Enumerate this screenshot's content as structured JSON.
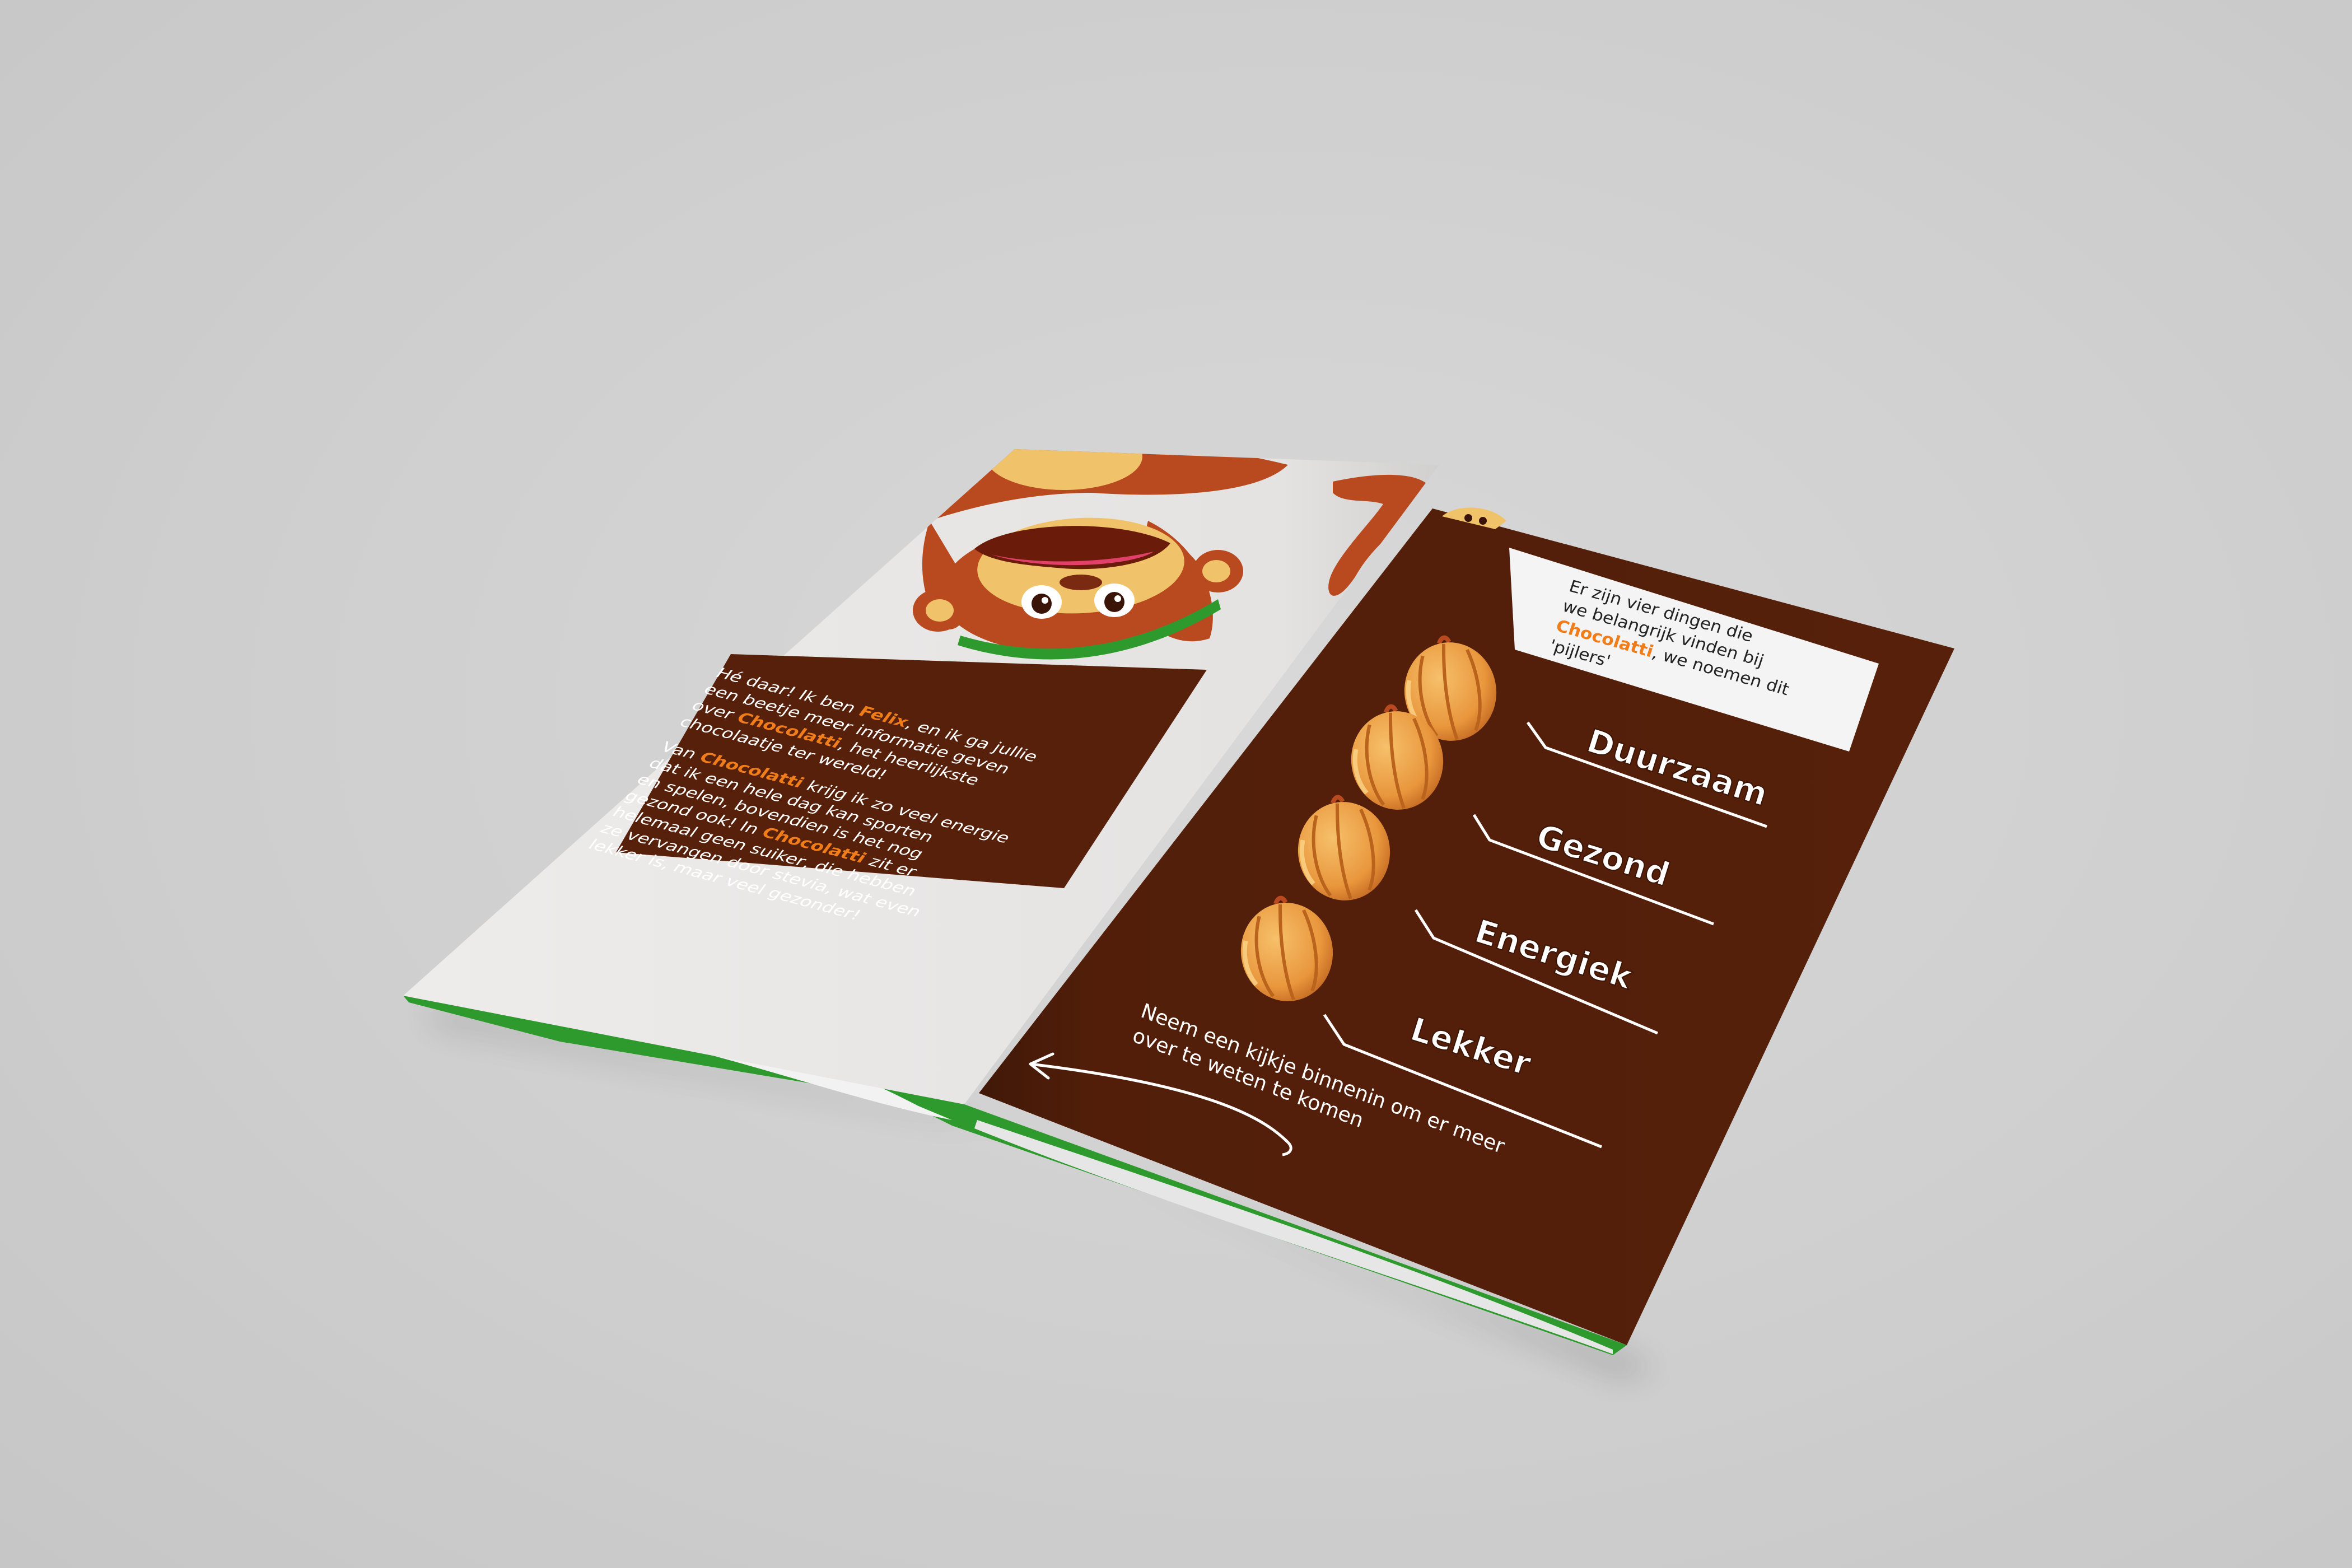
{
  "colors": {
    "background": "#cfcfcf",
    "brown_panel": "#56200a",
    "cream_panel": "#eeeceb",
    "green_inner": "#2e9a2e",
    "accent_orange": "#f07d1a",
    "cocoa_pod_orange": "#e9973d",
    "monkey_brown": "#b94a1f",
    "monkey_tan": "#f0c36b"
  },
  "left_panel": {
    "intro": [
      [
        "Hé daar! Ik ben ",
        {
          "hl": "Felix"
        },
        ", en ik ga jullie"
      ],
      [
        "een beetje meer informatie geven"
      ],
      [
        "over ",
        {
          "hl": "Chocolatti"
        },
        ", het heerlijkste"
      ],
      [
        "chocolaatje ter wereld!"
      ]
    ],
    "body": [
      [
        "Van ",
        {
          "hl": "Chocolatti"
        },
        " krijg ik zo veel energie"
      ],
      [
        "dat ik een hele dag kan sporten"
      ],
      [
        "en spelen, bovendien is het nog"
      ],
      [
        "gezond ook! In ",
        {
          "hl": "Chocolatti"
        },
        " zit er"
      ],
      [
        "helemaal geen suiker, die hebben"
      ],
      [
        "ze vervangen door stevia, wat even"
      ],
      [
        "lekker is, maar veel gezonder!"
      ]
    ]
  },
  "right_panel": {
    "callout": [
      [
        "Er zijn vier dingen die"
      ],
      [
        "we belangrijk vinden bij"
      ],
      [
        {
          "hl": "Chocolatti"
        },
        ", we noemen dit"
      ],
      [
        "'pijlers'"
      ]
    ],
    "pillars": [
      "Duurzaam",
      "Gezond",
      "Energiek",
      "Lekker"
    ],
    "footer": [
      [
        "Neem een kijkje binnenin om er meer"
      ],
      [
        "over te weten te komen"
      ]
    ]
  }
}
